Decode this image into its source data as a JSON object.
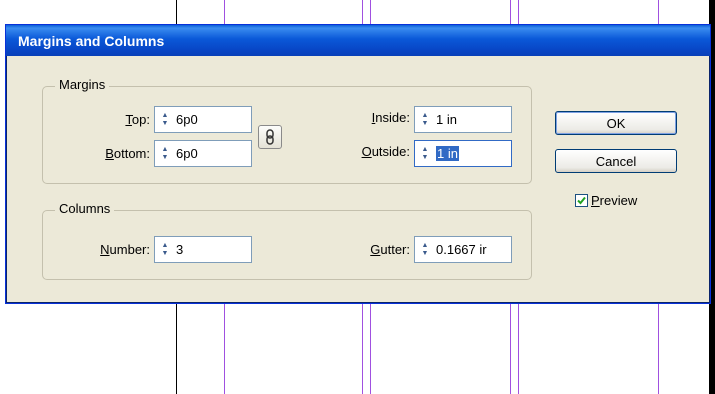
{
  "dialog": {
    "title": "Margins and Columns"
  },
  "margins": {
    "legend": "Margins",
    "top": {
      "label_key": "T",
      "label_rest": "op:",
      "value": "6p0"
    },
    "bottom": {
      "label_key": "B",
      "label_rest": "ottom:",
      "value": "6p0"
    },
    "inside": {
      "label_key": "I",
      "label_rest": "nside:",
      "value": "1 in"
    },
    "outside": {
      "label_key": "O",
      "label_rest": "utside:",
      "value": "1 in"
    }
  },
  "columns": {
    "legend": "Columns",
    "number": {
      "label_key": "N",
      "label_rest": "umber:",
      "value": "3"
    },
    "gutter": {
      "label_key": "G",
      "label_rest": "utter:",
      "value": "0.1667 ir"
    }
  },
  "buttons": {
    "ok": "OK",
    "cancel": "Cancel"
  },
  "preview": {
    "label_key": "P",
    "label_rest": "review",
    "checked": true
  },
  "colors": {
    "title_bar": "#0a58d8",
    "dialog_bg": "#ece9d8",
    "guide": "#a050e0",
    "selection": "#316ac5"
  },
  "icons": {
    "spin": "spinner-arrows-icon",
    "chain": "chain-link-icon",
    "check": "checkmark-icon"
  }
}
